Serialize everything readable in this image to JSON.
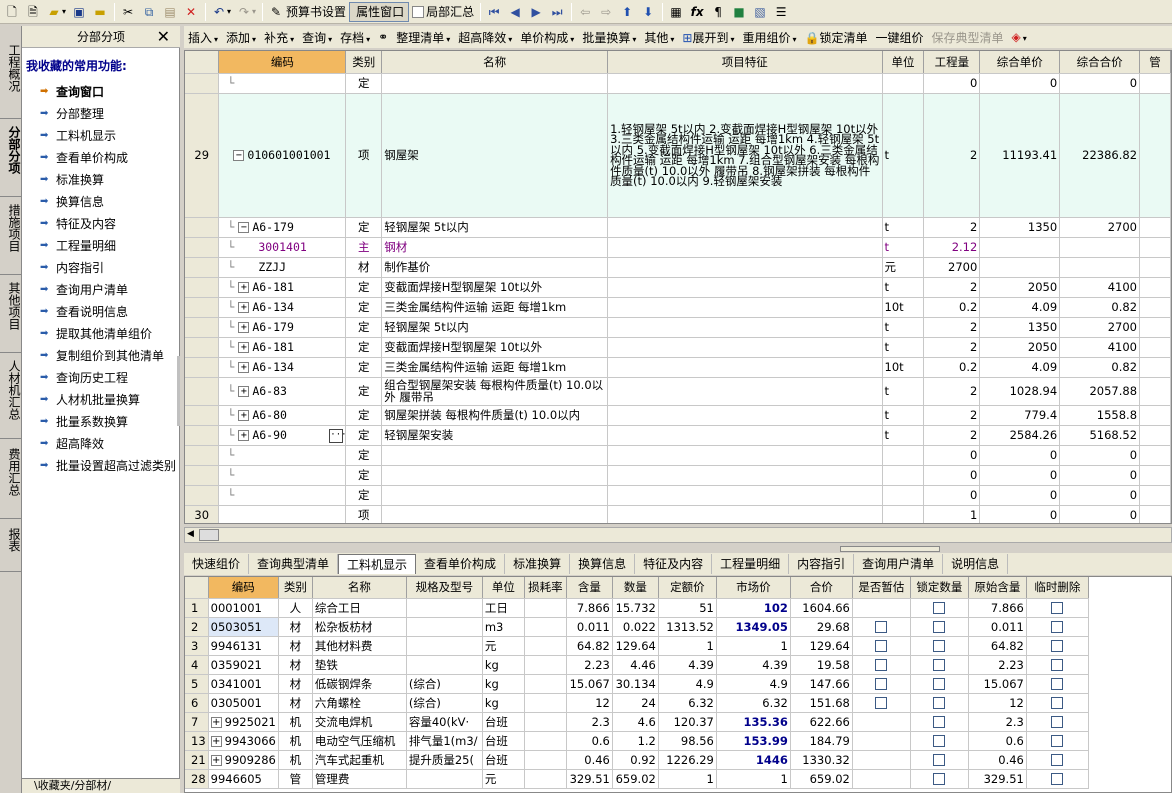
{
  "toolbar": {
    "budget_settings": "预算书设置",
    "property_window": "属性窗口",
    "partial_summary": "局部汇总"
  },
  "toolbar2": {
    "insert": "插入",
    "add": "添加",
    "supplement": "补充",
    "query": "查询",
    "archive": "存档",
    "organize_list": "整理清单",
    "super_height": "超高降效",
    "unit_price_comp": "单价构成",
    "batch_convert": "批量换算",
    "other": "其他",
    "expand_to": "展开到",
    "reuse_price": "重用组价",
    "lock_list": "锁定清单",
    "one_key_price": "一键组价",
    "save_typical": "保存典型清单"
  },
  "left_tabs": [
    "工程概况",
    "分部分项",
    "措施项目",
    "其他项目",
    "人材机汇总",
    "费用汇总",
    "报表"
  ],
  "side_panel": {
    "title": "分部分项",
    "close": "✕",
    "favorites_label": "我收藏的常用功能:",
    "items": [
      "查询窗口",
      "分部整理",
      "工料机显示",
      "查看单价构成",
      "标准换算",
      "换算信息",
      "特征及内容",
      "工程量明细",
      "内容指引",
      "查询用户清单",
      "查看说明信息",
      "提取其他清单组价",
      "复制组价到其他清单",
      "查询历史工程",
      "人材机批量换算",
      "批量系数换算",
      "超高降效",
      "批量设置超高过滤类别"
    ],
    "footer": "\\收藏夹/分部材/"
  },
  "main_grid": {
    "headers": [
      "编码",
      "类别",
      "名称",
      "项目特征",
      "单位",
      "工程量",
      "综合单价",
      "综合合价",
      "管"
    ],
    "rows": [
      {
        "num": "",
        "tree": "",
        "box": "",
        "code": "",
        "type": "定",
        "name": "",
        "feat": "",
        "unit": "",
        "qty": "0",
        "price": "0",
        "total": "0"
      },
      {
        "num": "29",
        "tree": "",
        "box": "−",
        "code": "010601001001",
        "type": "项",
        "name": "钢屋架",
        "feat": "1.轻钢屋架 5t以内\n2.变截面焊接H型钢屋架 10t以外\n3.三类金属结构件运输 运距 每增1km\n4.轻钢屋架 5t以内\n5.变截面焊接H型钢屋架 10t以外\n6.三类金属结构件运输 运距 每增1km\n7.组合型钢屋架安装 每根构件质量(t) 10.0以外 履带吊\n8.钢屋架拼装 每根构件质量(t) 10.0以内\n9.轻钢屋架安装",
        "unit": "t",
        "qty": "2",
        "price": "11193.41",
        "total": "22386.82",
        "xiang": true
      },
      {
        "num": "",
        "tree": "",
        "box": "−",
        "code": "A6-179",
        "type": "定",
        "name": "轻钢屋架 5t以内",
        "feat": "",
        "unit": "t",
        "qty": "2",
        "price": "1350",
        "total": "2700"
      },
      {
        "num": "",
        "tree": "",
        "box": "",
        "code": "3001401",
        "type": "主",
        "name": "钢材",
        "feat": "",
        "unit": "t",
        "qty": "2.12",
        "price": "",
        "total": "",
        "purple": true
      },
      {
        "num": "",
        "tree": "",
        "box": "",
        "code": "ZZJJ",
        "type": "材",
        "name": "制作基价",
        "feat": "",
        "unit": "元",
        "qty": "2700",
        "price": "",
        "total": ""
      },
      {
        "num": "",
        "tree": "",
        "box": "+",
        "code": "A6-181",
        "type": "定",
        "name": "变截面焊接H型钢屋架 10t以外",
        "feat": "",
        "unit": "t",
        "qty": "2",
        "price": "2050",
        "total": "4100"
      },
      {
        "num": "",
        "tree": "",
        "box": "+",
        "code": "A6-134",
        "type": "定",
        "name": "三类金属结构件运输 运距 每增1km",
        "feat": "",
        "unit": "10t",
        "qty": "0.2",
        "price": "4.09",
        "total": "0.82"
      },
      {
        "num": "",
        "tree": "",
        "box": "+",
        "code": "A6-179",
        "type": "定",
        "name": "轻钢屋架 5t以内",
        "feat": "",
        "unit": "t",
        "qty": "2",
        "price": "1350",
        "total": "2700"
      },
      {
        "num": "",
        "tree": "",
        "box": "+",
        "code": "A6-181",
        "type": "定",
        "name": "变截面焊接H型钢屋架 10t以外",
        "feat": "",
        "unit": "t",
        "qty": "2",
        "price": "2050",
        "total": "4100"
      },
      {
        "num": "",
        "tree": "",
        "box": "+",
        "code": "A6-134",
        "type": "定",
        "name": "三类金属结构件运输 运距 每增1km",
        "feat": "",
        "unit": "10t",
        "qty": "0.2",
        "price": "4.09",
        "total": "0.82"
      },
      {
        "num": "",
        "tree": "",
        "box": "+",
        "code": "A6-83",
        "type": "定",
        "name": "组合型钢屋架安装 每根构件质量(t) 10.0以外 履带吊",
        "feat": "",
        "unit": "t",
        "qty": "2",
        "price": "1028.94",
        "total": "2057.88",
        "tall": true
      },
      {
        "num": "",
        "tree": "",
        "box": "+",
        "code": "A6-80",
        "type": "定",
        "name": "钢屋架拼装 每根构件质量(t) 10.0以内",
        "feat": "",
        "unit": "t",
        "qty": "2",
        "price": "779.4",
        "total": "1558.8"
      },
      {
        "num": "",
        "tree": "",
        "box": "+",
        "code": "A6-90",
        "type": "定",
        "name": "轻钢屋架安装",
        "feat": "",
        "unit": "t",
        "qty": "2",
        "price": "2584.26",
        "total": "5168.52",
        "selected": true
      },
      {
        "num": "",
        "tree": "",
        "box": "",
        "code": "",
        "type": "定",
        "name": "",
        "feat": "",
        "unit": "",
        "qty": "0",
        "price": "0",
        "total": "0"
      },
      {
        "num": "",
        "tree": "",
        "box": "",
        "code": "",
        "type": "定",
        "name": "",
        "feat": "",
        "unit": "",
        "qty": "0",
        "price": "0",
        "total": "0"
      },
      {
        "num": "",
        "tree": "",
        "box": "",
        "code": "",
        "type": "定",
        "name": "",
        "feat": "",
        "unit": "",
        "qty": "0",
        "price": "0",
        "total": "0"
      },
      {
        "num": "30",
        "tree": "",
        "box": "",
        "code": "",
        "type": "项",
        "name": "",
        "feat": "",
        "unit": "",
        "qty": "1",
        "price": "0",
        "total": "0"
      }
    ]
  },
  "bottom_tabs": [
    "快速组价",
    "查询典型清单",
    "工料机显示",
    "查看单价构成",
    "标准换算",
    "换算信息",
    "特征及内容",
    "工程量明细",
    "内容指引",
    "查询用户清单",
    "说明信息"
  ],
  "bottom_grid": {
    "headers": [
      "编码",
      "类别",
      "名称",
      "规格及型号",
      "单位",
      "损耗率",
      "含量",
      "数量",
      "定额价",
      "市场价",
      "合价",
      "是否暂估",
      "锁定数量",
      "原始含量",
      "临时删除"
    ],
    "rows": [
      {
        "num": "1",
        "exp": "",
        "code": "0001001",
        "type": "人",
        "name": "综合工日",
        "spec": "",
        "unit": "工日",
        "loss": "",
        "content": "7.866",
        "qty": "15.732",
        "quota": "51",
        "market": "102",
        "total": "1604.66",
        "zg": false,
        "lock": true,
        "orig": "7.866",
        "del": true
      },
      {
        "num": "2",
        "exp": "",
        "code": "0503051",
        "type": "材",
        "name": "松杂板枋材",
        "spec": "",
        "unit": "m3",
        "loss": "",
        "content": "0.011",
        "qty": "0.022",
        "quota": "1313.52",
        "market": "1349.05",
        "total": "29.68",
        "zg": true,
        "lock": true,
        "orig": "0.011",
        "del": true,
        "selected": true
      },
      {
        "num": "3",
        "exp": "",
        "code": "9946131",
        "type": "材",
        "name": "其他材料费",
        "spec": "",
        "unit": "元",
        "loss": "",
        "content": "64.82",
        "qty": "129.64",
        "quota": "1",
        "market": "1",
        "total": "129.64",
        "zg": true,
        "lock": true,
        "orig": "64.82",
        "del": true
      },
      {
        "num": "4",
        "exp": "",
        "code": "0359021",
        "type": "材",
        "name": "垫铁",
        "spec": "",
        "unit": "kg",
        "loss": "",
        "content": "2.23",
        "qty": "4.46",
        "quota": "4.39",
        "market": "4.39",
        "total": "19.58",
        "zg": true,
        "lock": true,
        "orig": "2.23",
        "del": true
      },
      {
        "num": "5",
        "exp": "",
        "code": "0341001",
        "type": "材",
        "name": "低碳钢焊条",
        "spec": "(综合)",
        "unit": "kg",
        "loss": "",
        "content": "15.067",
        "qty": "30.134",
        "quota": "4.9",
        "market": "4.9",
        "total": "147.66",
        "zg": true,
        "lock": true,
        "orig": "15.067",
        "del": true
      },
      {
        "num": "6",
        "exp": "",
        "code": "0305001",
        "type": "材",
        "name": "六角螺栓",
        "spec": "(综合)",
        "unit": "kg",
        "loss": "",
        "content": "12",
        "qty": "24",
        "quota": "6.32",
        "market": "6.32",
        "total": "151.68",
        "zg": true,
        "lock": true,
        "orig": "12",
        "del": true
      },
      {
        "num": "7",
        "exp": "+",
        "code": "9925021",
        "type": "机",
        "name": "交流电焊机",
        "spec": "容量40(kV·",
        "unit": "台班",
        "loss": "",
        "content": "2.3",
        "qty": "4.6",
        "quota": "120.37",
        "market": "135.36",
        "total": "622.66",
        "zg": false,
        "lock": true,
        "orig": "2.3",
        "del": true
      },
      {
        "num": "13",
        "exp": "+",
        "code": "9943066",
        "type": "机",
        "name": "电动空气压缩机",
        "spec": "排气量1(m3/",
        "unit": "台班",
        "loss": "",
        "content": "0.6",
        "qty": "1.2",
        "quota": "98.56",
        "market": "153.99",
        "total": "184.79",
        "zg": false,
        "lock": true,
        "orig": "0.6",
        "del": true
      },
      {
        "num": "21",
        "exp": "+",
        "code": "9909286",
        "type": "机",
        "name": "汽车式起重机",
        "spec": "提升质量25(",
        "unit": "台班",
        "loss": "",
        "content": "0.46",
        "qty": "0.92",
        "quota": "1226.29",
        "market": "1446",
        "total": "1330.32",
        "zg": false,
        "lock": true,
        "orig": "0.46",
        "del": true
      },
      {
        "num": "28",
        "exp": "",
        "code": "9946605",
        "type": "管",
        "name": "管理费",
        "spec": "",
        "unit": "元",
        "loss": "",
        "content": "329.51",
        "qty": "659.02",
        "quota": "1",
        "market": "1",
        "total": "659.02",
        "zg": false,
        "lock": true,
        "orig": "329.51",
        "del": true
      }
    ]
  }
}
